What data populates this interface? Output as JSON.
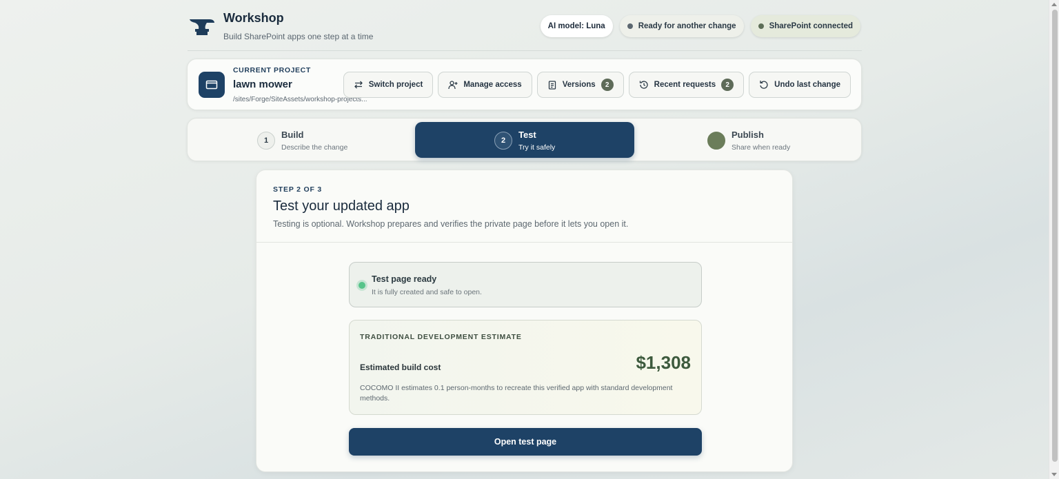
{
  "header": {
    "title": "Workshop",
    "subtitle": "Build SharePoint apps one step at a time",
    "pills": {
      "model": "AI model: Luna",
      "status": "Ready for another change",
      "connection": "SharePoint connected"
    }
  },
  "project": {
    "kicker": "CURRENT PROJECT",
    "name": "lawn mower",
    "path": "/sites/Forge/SiteAssets/workshop-projects...",
    "actions": {
      "switch": "Switch project",
      "access": "Manage access",
      "versions": "Versions",
      "versions_count": "2",
      "recent": "Recent requests",
      "recent_count": "2",
      "undo": "Undo last change"
    }
  },
  "steps": [
    {
      "num": "1",
      "title": "Build",
      "subtitle": "Describe the change"
    },
    {
      "num": "2",
      "title": "Test",
      "subtitle": "Try it safely"
    },
    {
      "num": "",
      "title": "Publish",
      "subtitle": "Share when ready"
    }
  ],
  "main": {
    "kicker": "STEP 2 OF 3",
    "title": "Test your updated app",
    "description": "Testing is optional. Workshop prepares and verifies the private page before it lets you open it.",
    "ready": {
      "title": "Test page ready",
      "subtitle": "It is fully created and safe to open."
    },
    "estimate": {
      "kicker": "TRADITIONAL DEVELOPMENT ESTIMATE",
      "label": "Estimated build cost",
      "value": "$1,308",
      "note": "COCOMO II estimates 0.1 person-months to recreate this verified app with standard development methods."
    },
    "open_button": "Open test page"
  },
  "colors": {
    "primary": "#1e4266",
    "accent_green": "#3d5a3d",
    "ready_dot": "#57c48a"
  }
}
